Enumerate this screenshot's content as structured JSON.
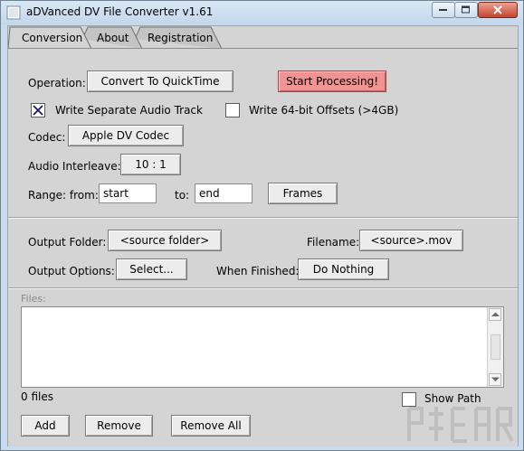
{
  "window": {
    "title": "aDVanced DV File Converter v1.61"
  },
  "tabs": [
    {
      "label": "Conversion",
      "active": true
    },
    {
      "label": "About",
      "active": false
    },
    {
      "label": "Registration",
      "active": false
    }
  ],
  "conversion": {
    "operation_label": "Operation:",
    "operation_value": "Convert To QuickTime",
    "start_button": "Start Processing!",
    "write_audio_label": "Write Separate Audio Track",
    "write_audio_checked": true,
    "write_64bit_label": "Write 64-bit Offsets (>4GB)",
    "write_64bit_checked": false,
    "codec_label": "Codec:",
    "codec_value": "Apple DV Codec",
    "interleave_label": "Audio Interleave:",
    "interleave_value": "10 : 1",
    "range_from_label": "Range: from:",
    "range_from_value": "start",
    "range_to_label": "to:",
    "range_to_value": "end",
    "frames_button": "Frames"
  },
  "output": {
    "folder_label": "Output Folder:",
    "folder_value": "<source folder>",
    "filename_label": "Filename:",
    "filename_value": "<source>.mov",
    "options_label": "Output Options:",
    "options_button": "Select...",
    "when_finished_label": "When Finished:",
    "when_finished_value": "Do Nothing"
  },
  "files": {
    "label": "Files:",
    "count_text": "0 files",
    "show_path_label": "Show Path",
    "show_path_checked": false,
    "add_button": "Add",
    "remove_button": "Remove",
    "remove_all_button": "Remove All"
  },
  "colors": {
    "start_button": "#f19393",
    "title_bar": "#c9dcef",
    "panel": "#d4d4d4"
  }
}
